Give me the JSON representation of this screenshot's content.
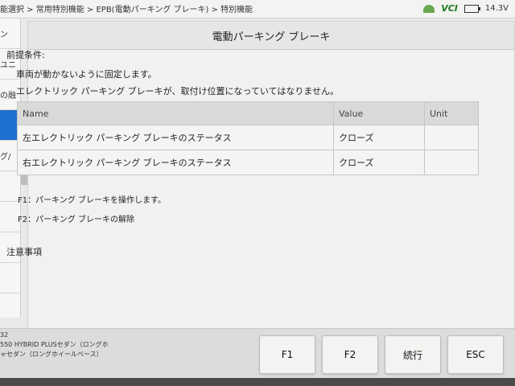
{
  "topbar": {
    "breadcrumb": "能選択 > 常用特別機能 > EPB(電動パーキング ブレーキ) > 特別機能",
    "vci_label": "VCI",
    "voltage": "14.3V",
    "icons": [
      "wifi-icon",
      "battery-icon"
    ]
  },
  "sidebar": {
    "items": [
      {
        "label": "ン"
      },
      {
        "label": "ユニ"
      },
      {
        "label": "の融"
      },
      {
        "label": ""
      },
      {
        "label": "グ/"
      },
      {
        "label": ""
      },
      {
        "label": ""
      },
      {
        "label": ""
      },
      {
        "label": ""
      }
    ]
  },
  "panel": {
    "title": "電動パーキング ブレーキ",
    "preconditions_title": "前提条件:",
    "preconditions": [
      "車両が動かないように固定します。",
      "エレクトリック パーキング ブレーキが、取付け位置になっていてはなりません。"
    ],
    "table": {
      "headers": {
        "name": "Name",
        "value": "Value",
        "unit": "Unit"
      },
      "rows": [
        {
          "name": "左エレクトリック パーキング ブレーキのステータス",
          "value": "クローズ",
          "unit": ""
        },
        {
          "name": "右エレクトリック パーキング ブレーキのステータス",
          "value": "クローズ",
          "unit": ""
        }
      ]
    },
    "fkey_notes": [
      "F1：パーキング ブレーキを操作します。",
      "F2：パーキング ブレーキの解除"
    ],
    "notes_title": "注意事項"
  },
  "bottombar": {
    "vehicle_lines": [
      "32",
      "550 HYBRID PLUSセダン（ロングホ",
      "ャセダン（ロングホイールベース）"
    ],
    "buttons": {
      "f1": "F1",
      "f2": "F2",
      "continue": "続行",
      "esc": "ESC"
    }
  },
  "colors": {
    "accent": "#1f6fd1",
    "vci": "#1e7b1e"
  }
}
